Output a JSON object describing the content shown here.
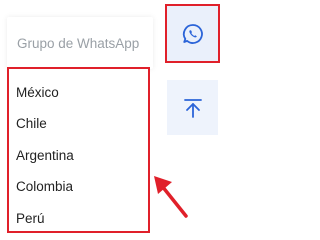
{
  "search": {
    "placeholder": "Grupo de WhatsApp"
  },
  "dropdown": {
    "options": [
      "México",
      "Chile",
      "Argentina",
      "Colombia",
      "Perú"
    ]
  },
  "sidebar": {
    "whatsapp_icon": "whatsapp-icon",
    "back_to_top_icon": "arrow-up-to-top-icon"
  },
  "colors": {
    "highlight_red": "#e0202a",
    "icon_blue": "#2b64d8",
    "button_bg": "#eaf0fb"
  }
}
